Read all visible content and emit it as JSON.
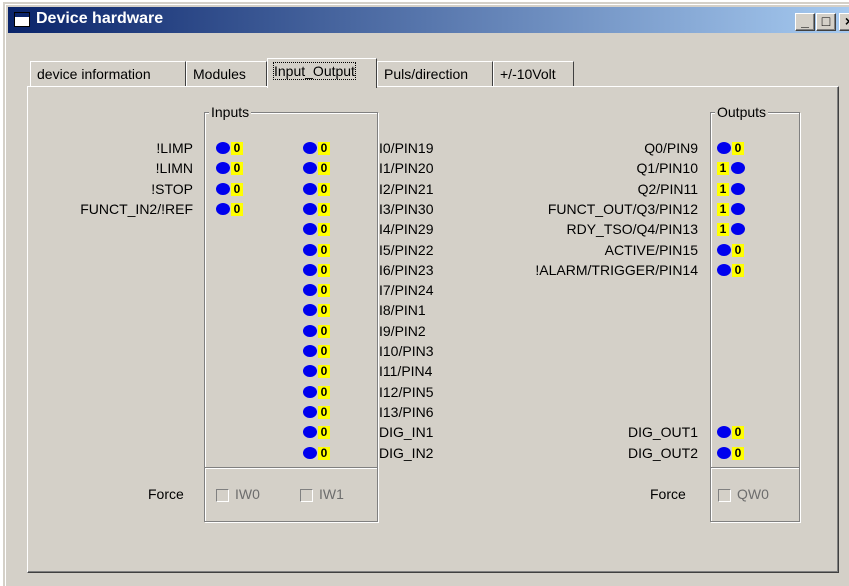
{
  "window": {
    "title": "Device hardware",
    "controls": {
      "minimize": "_",
      "maximize": "□",
      "close": "×"
    }
  },
  "tabs": [
    "device information",
    "Modules",
    "Input_Output",
    "Puls/direction",
    "+/-10Volt"
  ],
  "active_tab": "Input_Output",
  "inputs": {
    "caption": "Inputs",
    "left_signals": [
      {
        "label": "!LIMP",
        "value": "0"
      },
      {
        "label": "!LIMN",
        "value": "0"
      },
      {
        "label": "!STOP",
        "value": "0"
      },
      {
        "label": "FUNCT_IN2/!REF",
        "value": "0"
      }
    ],
    "right_signals": [
      {
        "label": "I0/PIN19",
        "value": "0"
      },
      {
        "label": "I1/PIN20",
        "value": "0"
      },
      {
        "label": "I2/PIN21",
        "value": "0"
      },
      {
        "label": "I3/PIN30",
        "value": "0"
      },
      {
        "label": "I4/PIN29",
        "value": "0"
      },
      {
        "label": "I5/PIN22",
        "value": "0"
      },
      {
        "label": "I6/PIN23",
        "value": "0"
      },
      {
        "label": "I7/PIN24",
        "value": "0"
      },
      {
        "label": "I8/PIN1",
        "value": "0"
      },
      {
        "label": "I9/PIN2",
        "value": "0"
      },
      {
        "label": "I10/PIN3",
        "value": "0"
      },
      {
        "label": "I11/PIN4",
        "value": "0"
      },
      {
        "label": "I12/PIN5",
        "value": "0"
      },
      {
        "label": "I13/PIN6",
        "value": "0"
      },
      {
        "label": "DIG_IN1",
        "value": "0"
      },
      {
        "label": "DIG_IN2",
        "value": "0"
      }
    ],
    "force_label": "Force",
    "force_checkboxes": [
      "IW0",
      "IW1"
    ]
  },
  "outputs": {
    "caption": "Outputs",
    "signals": [
      {
        "label": "Q0/PIN9",
        "value": "0"
      },
      {
        "label": "Q1/PIN10",
        "value": "1"
      },
      {
        "label": "Q2/PIN11",
        "value": "1"
      },
      {
        "label": "FUNCT_OUT/Q3/PIN12",
        "value": "1"
      },
      {
        "label": "RDY_TSO/Q4/PIN13",
        "value": "1"
      },
      {
        "label": "ACTIVE/PIN15",
        "value": "0"
      },
      {
        "label": "!ALARM/TRIGGER/PIN14",
        "value": "0"
      }
    ],
    "dig_signals": [
      {
        "label": "DIG_OUT1",
        "value": "0"
      },
      {
        "label": "DIG_OUT2",
        "value": "0"
      }
    ],
    "force_label": "Force",
    "force_checkboxes": [
      "QW0"
    ]
  },
  "colors": {
    "led_on_background": "#ffff00",
    "led_dot": "#0000ee",
    "titlebar_start": "#0a246a",
    "face": "#d4d0c8"
  }
}
